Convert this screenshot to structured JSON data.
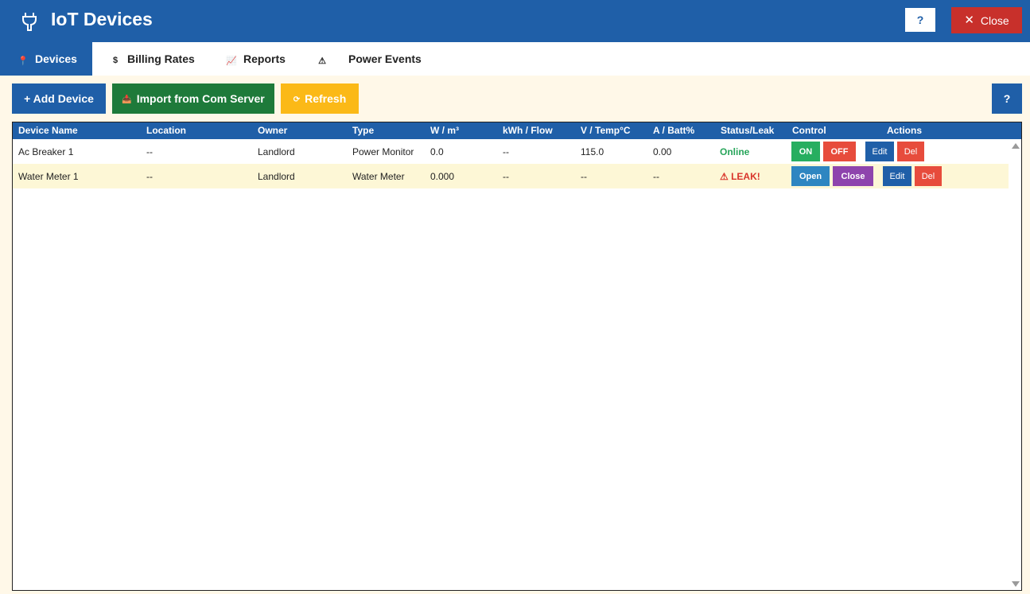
{
  "window": {
    "title": "IoT Devices",
    "help_label": "?",
    "close_label": "Close"
  },
  "tabs": [
    {
      "label": "Devices",
      "icon": "pin-icon",
      "active": true
    },
    {
      "label": "Billing Rates",
      "icon": "dollar-icon",
      "active": false
    },
    {
      "label": "Reports",
      "icon": "chart-icon",
      "active": false
    },
    {
      "label": "Power Events",
      "icon": "warning-icon",
      "active": false
    }
  ],
  "toolbar": {
    "add_label": "+ Add Device",
    "import_label": "Import from Com Server",
    "refresh_label": "Refresh",
    "help_label": "?"
  },
  "table": {
    "columns": [
      "Device Name",
      "Location",
      "Owner",
      "Type",
      "W / m³",
      "kWh / Flow",
      "V / Temp°C",
      "A / Batt%",
      "Status/Leak",
      "Control",
      "Actions"
    ],
    "rows": [
      {
        "name": "Ac Breaker 1",
        "location": "--",
        "owner": "Landlord",
        "type": "Power Monitor",
        "w": "0.0",
        "kwh": "--",
        "v": "115.0",
        "a": "0.00",
        "status": "Online",
        "control": [
          "ON",
          "OFF"
        ],
        "actions": [
          "Edit",
          "Del"
        ]
      },
      {
        "name": "Water Meter 1",
        "location": "--",
        "owner": "Landlord",
        "type": "Water Meter",
        "w": "0.000",
        "kwh": "--",
        "v": "--",
        "a": "--",
        "status": "⚠ LEAK!",
        "control": [
          "Open",
          "Close"
        ],
        "actions": [
          "Edit",
          "Del"
        ]
      }
    ]
  },
  "colors": {
    "primary": "#1f5fa8",
    "danger": "#e74c3c",
    "success": "#27ae60",
    "warning": "#fbb917",
    "import": "#1e7a3a",
    "purple": "#8e44ad"
  }
}
